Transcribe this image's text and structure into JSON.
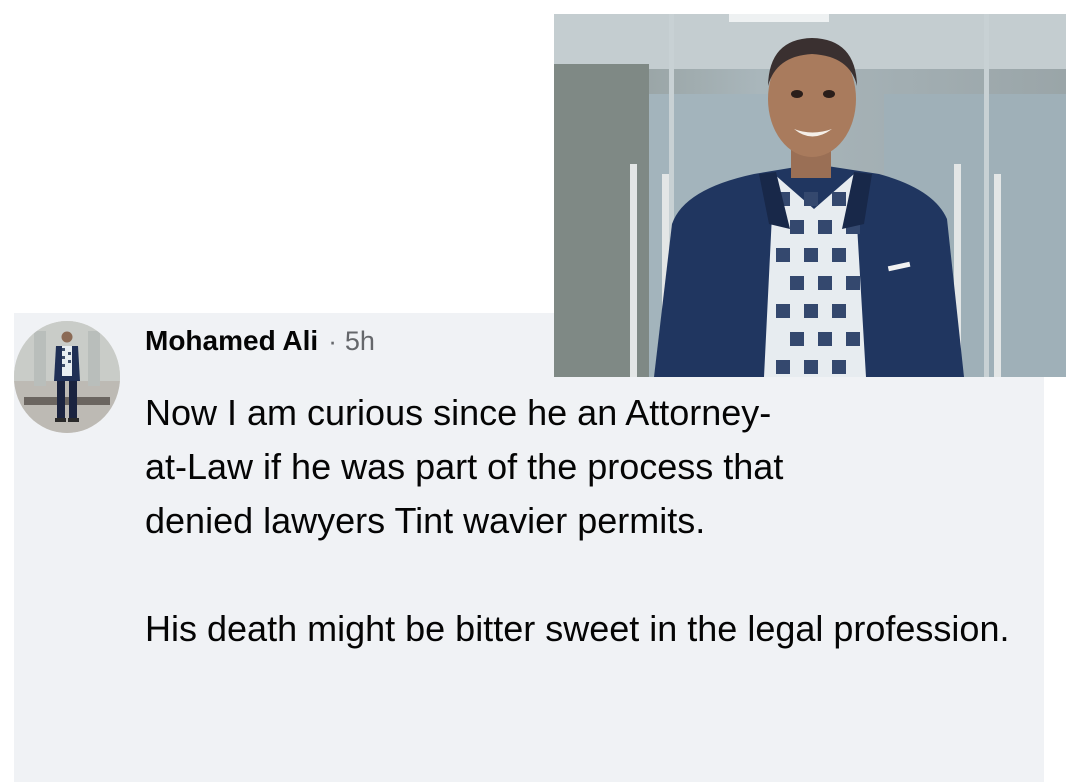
{
  "comment": {
    "author": "Mohamed Ali",
    "separator": "·",
    "time": "5h",
    "paragraphs": [
      "Now I am curious since he an Attorney-at-Law if he was part of the process that denied lawyers Tint wavier permits.",
      "His death might be bitter sweet in the legal profession."
    ]
  },
  "colors": {
    "card_background": "#f0f2f5",
    "primary_text": "#050505",
    "secondary_text": "#65676b",
    "blazer": "#203660"
  },
  "icons": {
    "avatar": "profile-photo-man-standing",
    "photo": "photo-smiling-man-blue-blazer-checked-shirt"
  }
}
